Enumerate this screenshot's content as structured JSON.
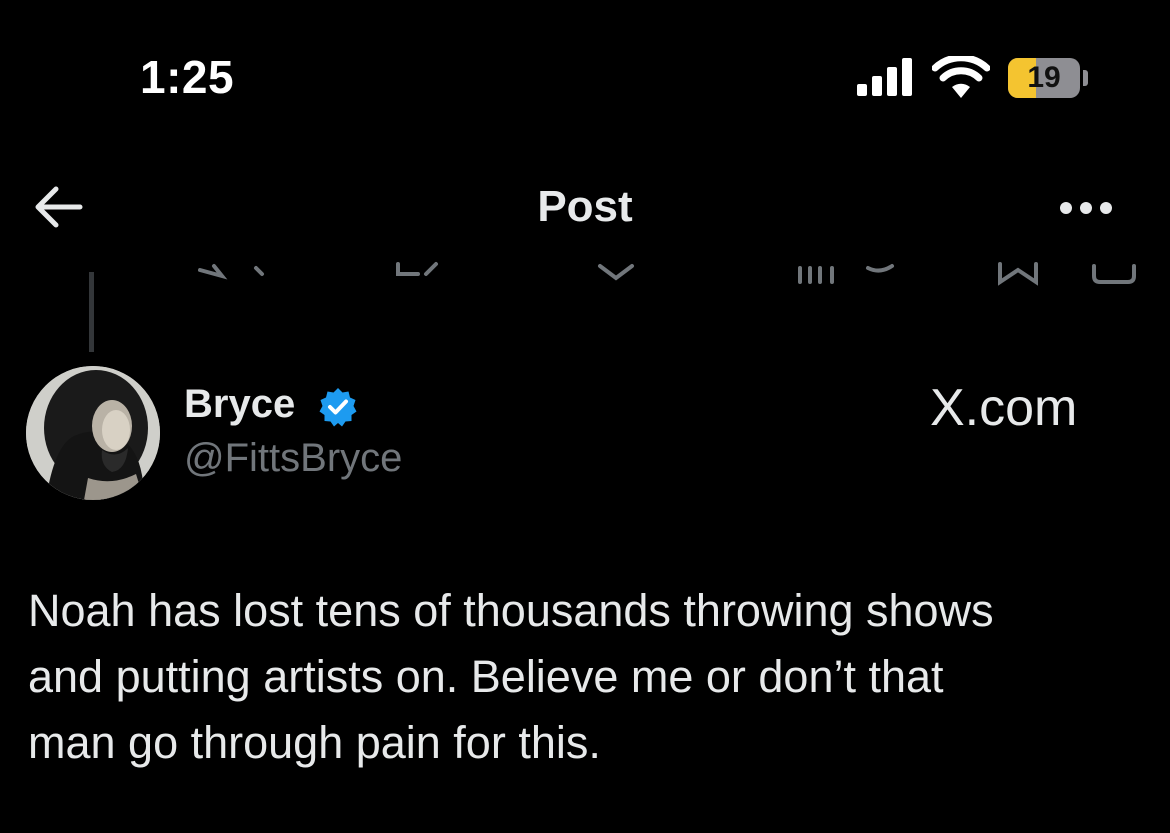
{
  "status_bar": {
    "time": "1:25",
    "battery_level": "19",
    "battery_fraction": 0.19
  },
  "header": {
    "title": "Post"
  },
  "post": {
    "author_name": "Bryce",
    "author_handle": "@FittsBryce",
    "verified": true,
    "source_label": "X.com",
    "text_lines": [
      "Noah has lost tens of thousands throwing shows",
      "and putting artists on. Believe me or don’t that",
      "man go through pain for this."
    ]
  },
  "colors": {
    "background": "#000000",
    "text_primary": "#e7e9ea",
    "text_secondary": "#71767b",
    "verified_blue": "#1d9bf0",
    "battery_low": "#f4c430"
  },
  "icons": [
    "signal-icon",
    "wifi-icon",
    "battery-icon",
    "back-arrow-icon",
    "more-icon",
    "verified-badge-icon"
  ]
}
